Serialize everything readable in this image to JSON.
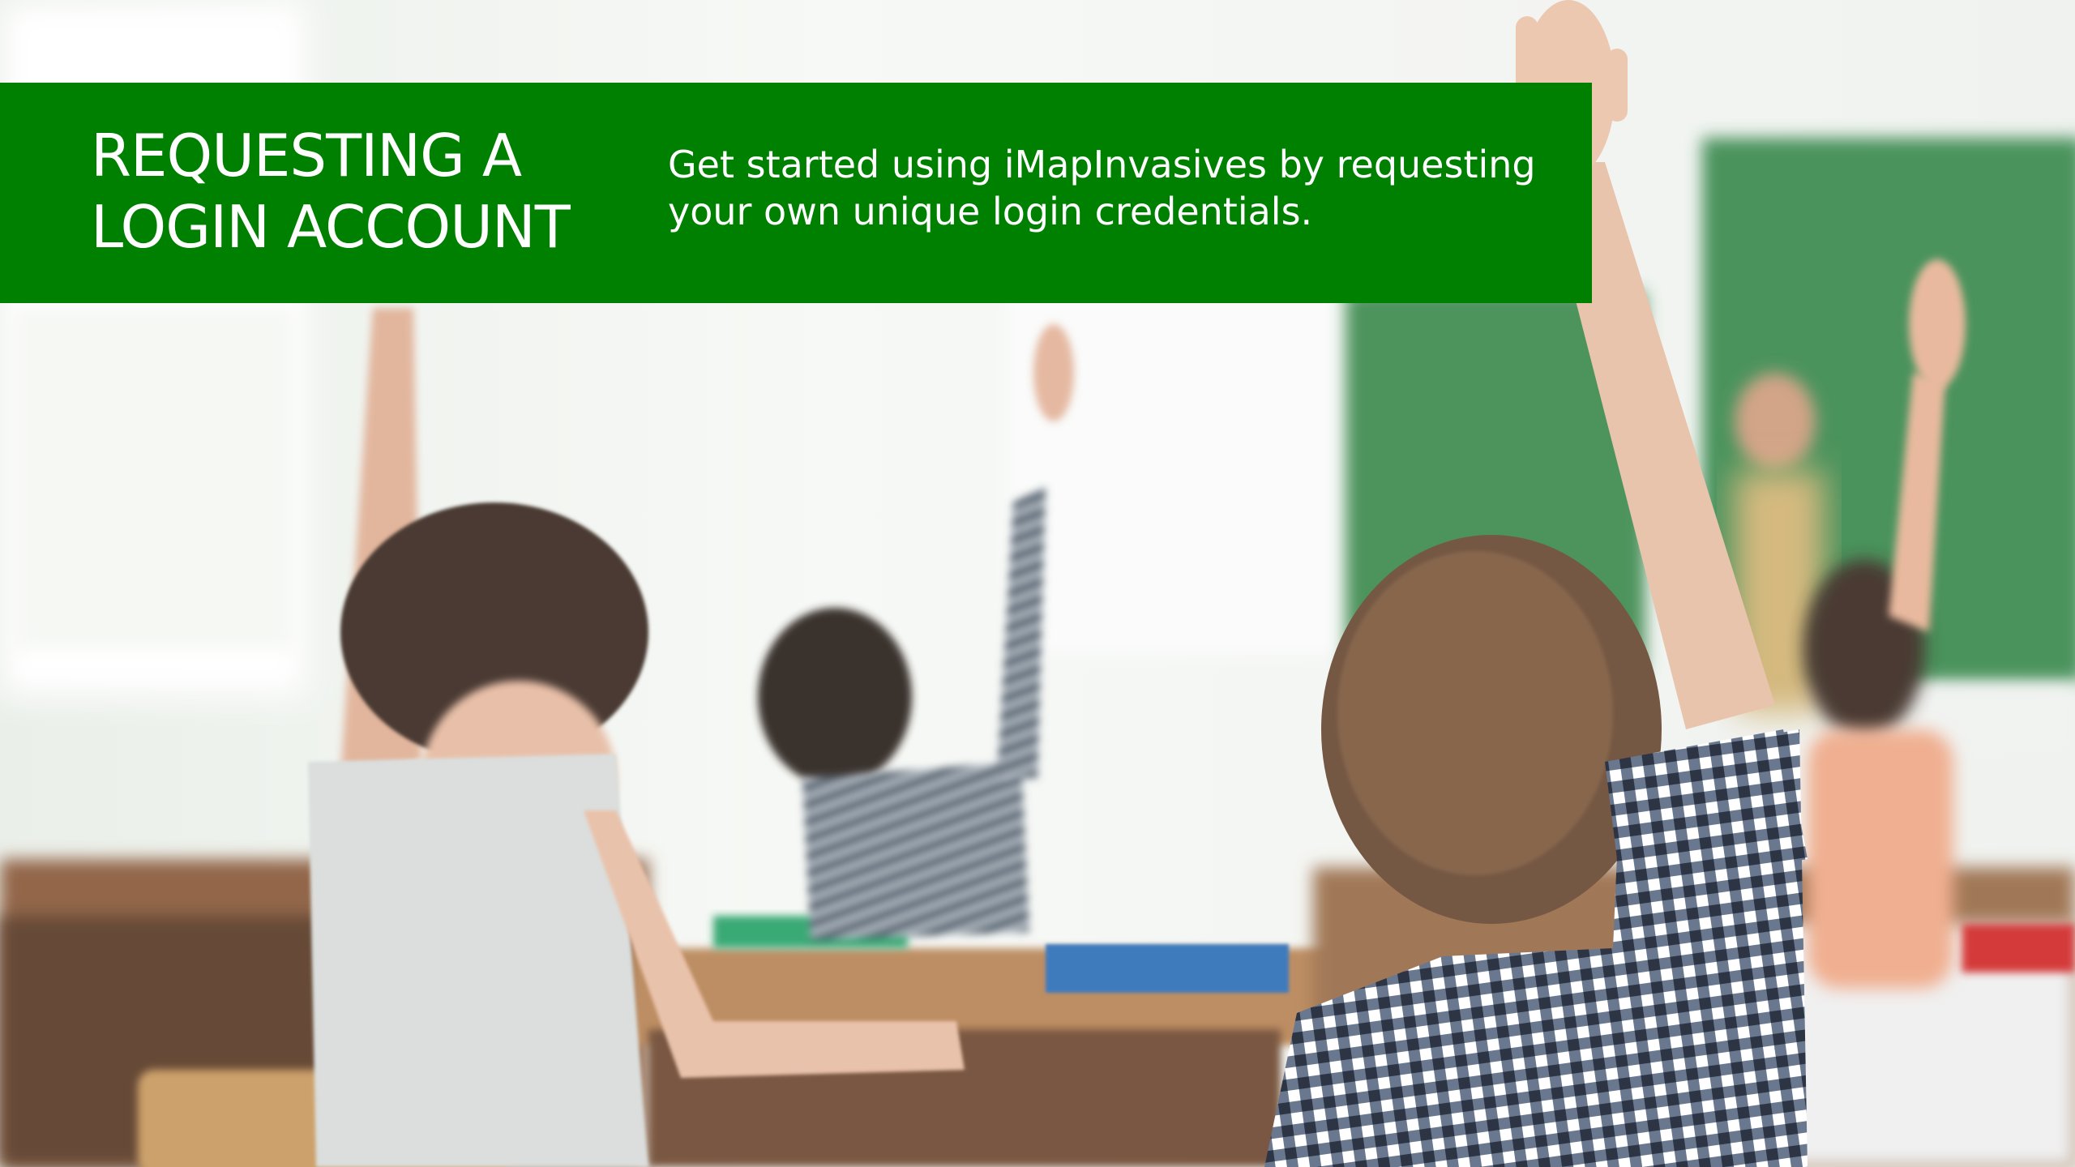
{
  "banner": {
    "title_line1": "REQUESTING A",
    "title_line2": "LOGIN ACCOUNT",
    "subtitle_line1": "Get started using iMapInvasives by requesting",
    "subtitle_line2": "your own unique login credentials."
  },
  "colors": {
    "banner_green": "#008000",
    "text": "#ffffff"
  }
}
